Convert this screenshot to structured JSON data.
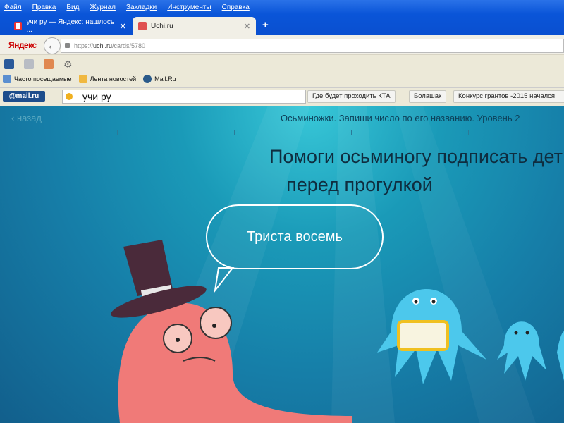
{
  "menu": [
    "Файл",
    "Правка",
    "Вид",
    "Журнал",
    "Закладки",
    "Инструменты",
    "Справка"
  ],
  "tabs": [
    {
      "title": "учи ру — Яндекс: нашлось ..."
    },
    {
      "title": "Uchi.ru"
    }
  ],
  "nav": {
    "yandex": "Яндекс",
    "url_prefix": "https://",
    "url_domain": "uchi.ru",
    "url_path": "/cards/5780"
  },
  "bookmarks": [
    "Часто посещаемые",
    "Лента новостей",
    "Mail.Ru"
  ],
  "mailbar": {
    "logo": "@mail.ru",
    "search": "учи ру",
    "buttons": [
      "Где будет проходить КТА",
      "Болашак",
      "Конкурс грантов -2015 начался"
    ]
  },
  "page": {
    "back": "назад",
    "lesson": "Осьминожки. Запиши число по его названию. Уровень 2",
    "title_line1": "Помоги осьминогу подписать дет",
    "title_line2": "перед прогулкой",
    "bubble": "Триста восемь"
  }
}
